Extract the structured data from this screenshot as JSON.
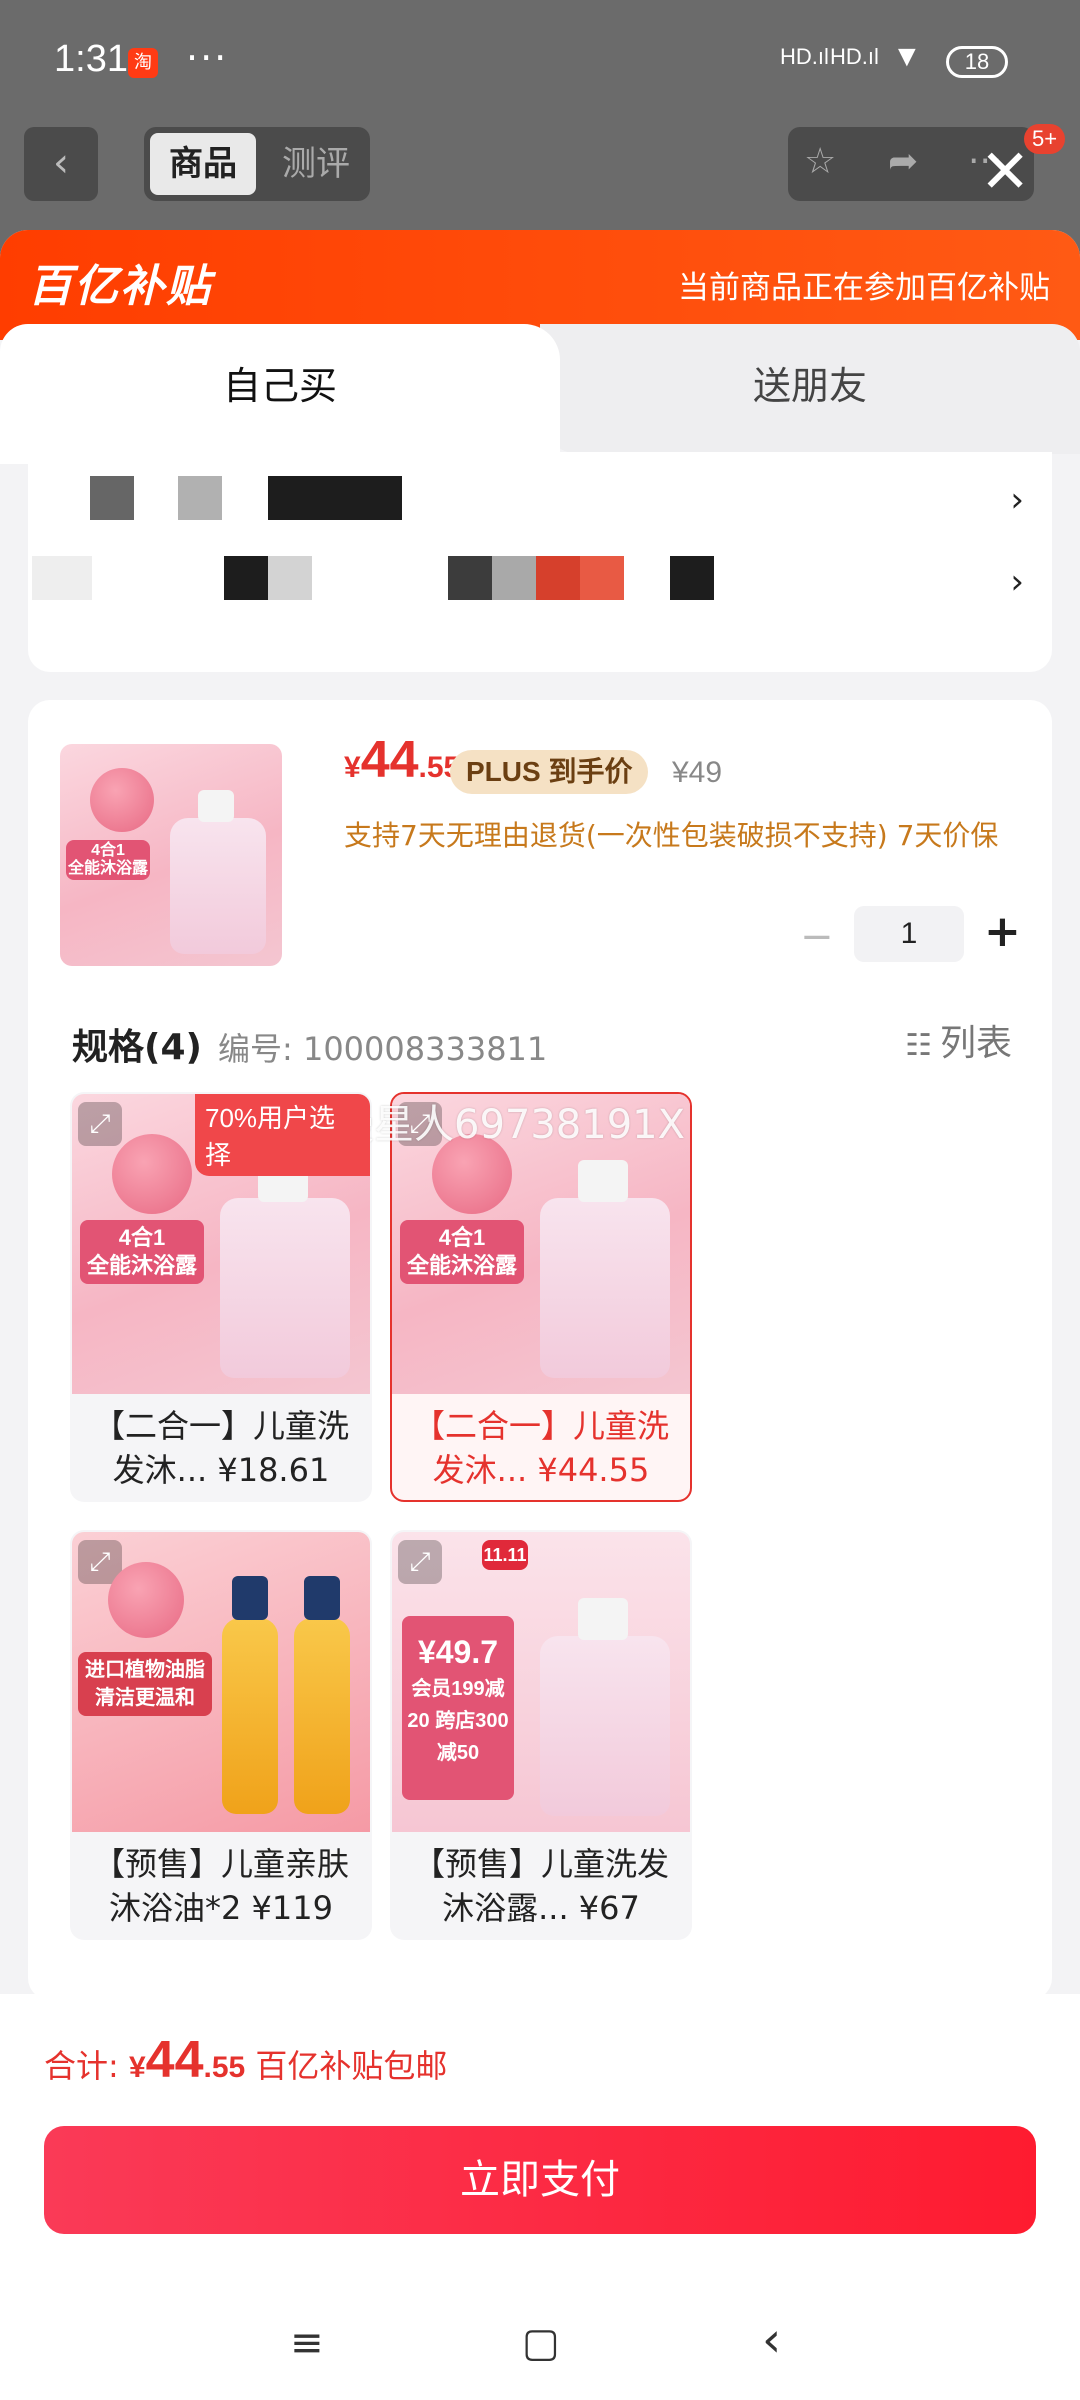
{
  "status": {
    "time": "1:31",
    "app_icon": "淘",
    "more": "···",
    "signal1": "HD",
    "signal2": "HD",
    "battery": "18"
  },
  "background_header": {
    "back": "‹",
    "tab_active": "商品",
    "tab_other": "测评",
    "badge": "5+"
  },
  "sheet": {
    "brand": "百亿补贴",
    "notice": "当前商品正在参加百亿补贴",
    "tab_self": "自己买",
    "tab_gift": "送朋友"
  },
  "product": {
    "price_currency": "¥",
    "price_int": "44",
    "price_dec": ".55",
    "plus_tag": "PLUS 到手价",
    "orig_price": "¥49",
    "policy": "支持7天无理由退货(一次性包装破损不支持) 7天价保",
    "qty": "1",
    "qty_minus": "−",
    "qty_plus": "+"
  },
  "spec": {
    "title": "规格(4)",
    "code": "编号: 100008333811",
    "list_label": "列表",
    "watermark": "慢星人69738191X",
    "items": [
      {
        "label": "【二合一】儿童洗发沐...  ¥18.61",
        "tag": "70%用户选择",
        "badge_line1": "4合1",
        "badge_line2": "全能沐浴露"
      },
      {
        "label": "【二合一】儿童洗发沐...  ¥44.55",
        "badge_line1": "4合1",
        "badge_line2": "全能沐浴露"
      },
      {
        "label": "【预售】儿童亲肤沐浴油*2  ¥119",
        "badge_line1": "进口植物油脂",
        "badge_line2": "清洁更温和"
      },
      {
        "label": "【预售】儿童洗发沐浴露...  ¥67",
        "badge_line1": "¥49.7",
        "badge_line2": "会员199减20 跨店300减50",
        "corner": "11.11"
      }
    ]
  },
  "footer": {
    "total_label": "合计: ",
    "total_currency": "¥",
    "total_int": "44",
    "total_dec": ".55",
    "total_note": " 百亿补贴包邮",
    "pay_button": "立即支付"
  },
  "navbar": {
    "menu": "≡",
    "home": "▢",
    "back": "‹"
  },
  "colors": {
    "accent": "#e5322d",
    "brand_orange": "#ff4a0a",
    "pay_button": "#fe1b30"
  }
}
